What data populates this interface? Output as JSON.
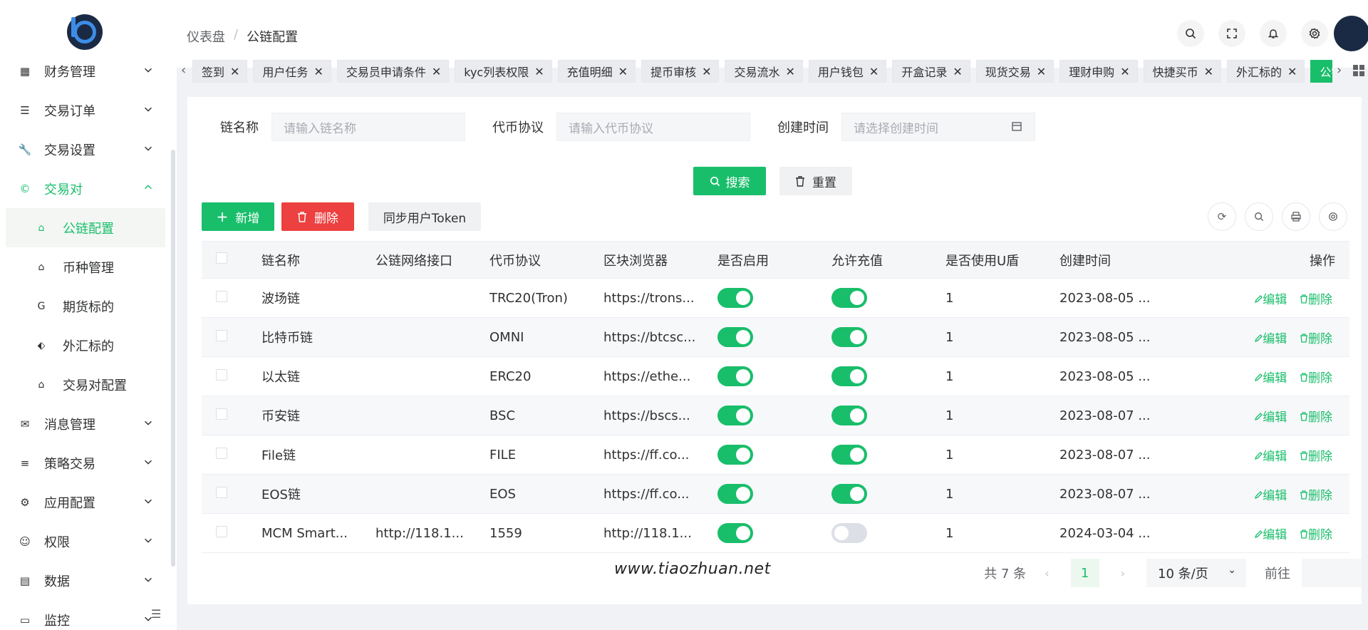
{
  "sidebar": {
    "items": [
      {
        "label": "财务管理",
        "icon": "table-icon"
      },
      {
        "label": "交易订单",
        "icon": "list-icon"
      },
      {
        "label": "交易设置",
        "icon": "wrench-icon"
      },
      {
        "label": "交易对",
        "icon": "copyright-icon",
        "active": true
      }
    ],
    "subitems": [
      {
        "label": "公链配置",
        "icon": "home-icon",
        "active": true
      },
      {
        "label": "币种管理",
        "icon": "home-icon"
      },
      {
        "label": "期货标的",
        "icon": "g-icon"
      },
      {
        "label": "外汇标的",
        "icon": "tag-icon"
      },
      {
        "label": "交易对配置",
        "icon": "home-icon"
      }
    ],
    "items2": [
      {
        "label": "消息管理",
        "icon": "mail-icon"
      },
      {
        "label": "策略交易",
        "icon": "menu-icon"
      },
      {
        "label": "应用配置",
        "icon": "settings-icon"
      },
      {
        "label": "权限",
        "icon": "user-icon"
      },
      {
        "label": "数据",
        "icon": "database-icon"
      },
      {
        "label": "监控",
        "icon": "monitor-icon"
      }
    ]
  },
  "breadcrumb": {
    "home": "仪表盘",
    "sep": "/",
    "current": "公链配置"
  },
  "tags": [
    "签到",
    "用户任务",
    "交易员申请条件",
    "kyc列表权限",
    "充值明细",
    "提币审核",
    "交易流水",
    "用户钱包",
    "开盒记录",
    "现货交易",
    "理财申购",
    "快捷买币",
    "外汇标的",
    "公链配置"
  ],
  "form": {
    "chain_label": "链名称",
    "chain_placeholder": "请输入链名称",
    "protocol_label": "代币协议",
    "protocol_placeholder": "请输入代币协议",
    "time_label": "创建时间",
    "time_placeholder": "请选择创建时间",
    "search_btn": "搜索",
    "reset_btn": "重置"
  },
  "toolbar": {
    "add": "新增",
    "delete": "删除",
    "sync": "同步用户Token"
  },
  "table": {
    "headers": [
      "链名称",
      "公链网络接口",
      "代币协议",
      "区块浏览器",
      "是否启用",
      "允许充值",
      "是否使用U盾",
      "创建时间",
      "操作"
    ],
    "edit_label": "编辑",
    "delete_label": "删除",
    "rows": [
      {
        "name": "波场链",
        "api": "",
        "protocol": "TRC20(Tron)",
        "explorer": "https://trons...",
        "enabled": true,
        "recharge": true,
        "ukey": "1",
        "created": "2023-08-05 ..."
      },
      {
        "name": "比特币链",
        "api": "",
        "protocol": "OMNI",
        "explorer": "https://btcsc...",
        "enabled": true,
        "recharge": true,
        "ukey": "1",
        "created": "2023-08-05 ..."
      },
      {
        "name": "以太链",
        "api": "",
        "protocol": "ERC20",
        "explorer": "https://ethe...",
        "enabled": true,
        "recharge": true,
        "ukey": "1",
        "created": "2023-08-05 ..."
      },
      {
        "name": "币安链",
        "api": "",
        "protocol": "BSC",
        "explorer": "https://bscs...",
        "enabled": true,
        "recharge": true,
        "ukey": "1",
        "created": "2023-08-07 ..."
      },
      {
        "name": "File链",
        "api": "",
        "protocol": "FILE",
        "explorer": "https://ff.co...",
        "enabled": true,
        "recharge": true,
        "ukey": "1",
        "created": "2023-08-07 ..."
      },
      {
        "name": "EOS链",
        "api": "",
        "protocol": "EOS",
        "explorer": "https://ff.co...",
        "enabled": true,
        "recharge": true,
        "ukey": "1",
        "created": "2023-08-07 ..."
      },
      {
        "name": "MCM Smart...",
        "api": "http://118.1...",
        "protocol": "1559",
        "explorer": "http://118.1...",
        "enabled": true,
        "recharge": false,
        "ukey": "1",
        "created": "2024-03-04 ..."
      }
    ]
  },
  "pager": {
    "total": "共 7 条",
    "page": "1",
    "size": "10 条/页",
    "goto": "前往"
  },
  "watermark": "www.tiaozhuan.net",
  "colors": {
    "accent": "#19be6b",
    "danger": "#ed4040"
  }
}
